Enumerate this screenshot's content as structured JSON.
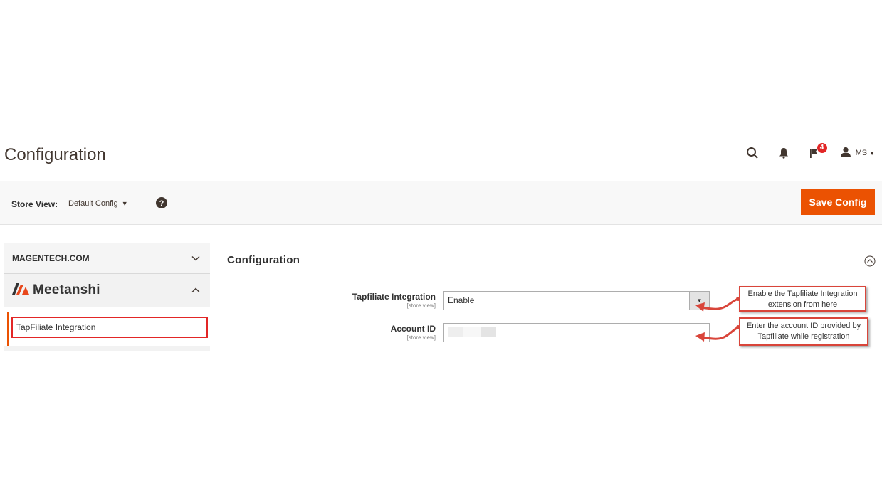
{
  "header": {
    "title": "Configuration",
    "notification_count": "4",
    "user_name": "MS"
  },
  "toolbar": {
    "store_view_label": "Store View:",
    "store_view_value": "Default Config",
    "save_label": "Save Config"
  },
  "sidebar": {
    "tab_label": "MAGENTECH.COM",
    "brand_name": "Meetanshi",
    "active_item": "TapFiliate Integration"
  },
  "section": {
    "title": "Configuration",
    "fields": [
      {
        "label": "Tapfiliate Integration",
        "scope": "[store view]",
        "value": "Enable"
      },
      {
        "label": "Account ID",
        "scope": "[store view]",
        "value": ""
      }
    ]
  },
  "callouts": {
    "enable_note": "Enable the Tapfiliate Integration extension from here",
    "account_note": "Enter the account ID provided by Tapfiliate while registration"
  },
  "colors": {
    "accent": "#eb5202",
    "highlight": "#e22626",
    "brand": "#e8471b"
  }
}
